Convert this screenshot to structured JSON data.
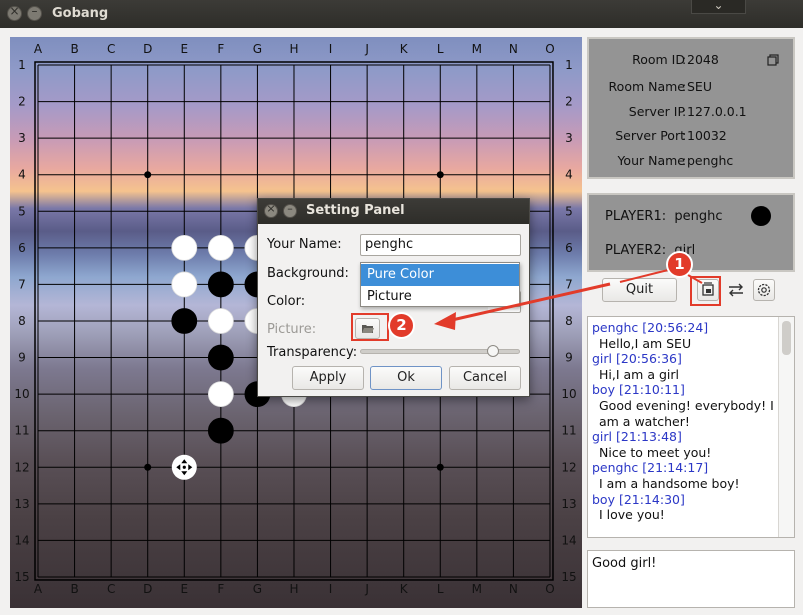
{
  "window": {
    "title": "Gobang",
    "menu_glyph": "⌄"
  },
  "board": {
    "column_labels": [
      "A",
      "B",
      "C",
      "D",
      "E",
      "F",
      "G",
      "H",
      "I",
      "J",
      "K",
      "L",
      "M",
      "N",
      "O"
    ],
    "row_labels": [
      "1",
      "2",
      "3",
      "4",
      "5",
      "6",
      "7",
      "8",
      "9",
      "10",
      "11",
      "12",
      "13",
      "14",
      "15"
    ],
    "star_points": [
      [
        "D",
        4
      ],
      [
        "L",
        4
      ],
      [
        "D",
        12
      ],
      [
        "L",
        12
      ]
    ],
    "stones": [
      {
        "col": "E",
        "row": 6,
        "color": "white"
      },
      {
        "col": "F",
        "row": 6,
        "color": "white"
      },
      {
        "col": "G",
        "row": 6,
        "color": "white"
      },
      {
        "col": "E",
        "row": 7,
        "color": "white"
      },
      {
        "col": "F",
        "row": 7,
        "color": "black"
      },
      {
        "col": "G",
        "row": 7,
        "color": "black"
      },
      {
        "col": "E",
        "row": 8,
        "color": "black"
      },
      {
        "col": "F",
        "row": 8,
        "color": "white"
      },
      {
        "col": "G",
        "row": 8,
        "color": "white"
      },
      {
        "col": "F",
        "row": 9,
        "color": "black"
      },
      {
        "col": "F",
        "row": 10,
        "color": "white"
      },
      {
        "col": "G",
        "row": 10,
        "color": "black"
      },
      {
        "col": "H",
        "row": 10,
        "color": "white"
      },
      {
        "col": "F",
        "row": 11,
        "color": "black"
      }
    ],
    "cursor": {
      "col": "E",
      "row": 12
    }
  },
  "room": {
    "rows": [
      {
        "label": "Room  ID",
        "value": "2048"
      },
      {
        "label": "Room Name",
        "value": "SEU"
      },
      {
        "label": "Server IP",
        "value": "127.0.0.1"
      },
      {
        "label": "Server Port",
        "value": "10032"
      },
      {
        "label": "Your Name",
        "value": "penghc"
      }
    ],
    "copy_icon": "copy-icon"
  },
  "players": {
    "p1_label": "PLAYER1:",
    "p1_name": "penghc",
    "p2_label": "PLAYER2:",
    "p2_name": "girl"
  },
  "controls": {
    "quit_label": "Quit",
    "icons": [
      "screenshot-icon",
      "swap-icon",
      "settings-gear-icon"
    ]
  },
  "chat": {
    "messages": [
      {
        "head": "penghc [20:56:24]",
        "body": "Hello,I am SEU"
      },
      {
        "head": "girl [20:56:36]",
        "body": "Hi,I am a girl"
      },
      {
        "head": "boy [21:10:11]",
        "body": "Good evening! everybody! I am a watcher!"
      },
      {
        "head": "girl [21:13:48]",
        "body": "Nice to meet you!"
      },
      {
        "head": "penghc [21:14:17]",
        "body": "I am a handsome boy!"
      },
      {
        "head": "boy [21:14:30]",
        "body": "I love you!"
      }
    ],
    "input_value": "Good girl!"
  },
  "dialog": {
    "title": "Setting Panel",
    "name_label": "Your Name:",
    "name_value": "penghc",
    "background_label": "Background:",
    "background_options": [
      "Pure Color",
      "Picture"
    ],
    "background_selected": "Pure Color",
    "color_label": "Color:",
    "picture_label": "Picture:",
    "transparency_label": "Transparency:",
    "transparency_value": 0.84,
    "apply_label": "Apply",
    "ok_label": "Ok",
    "cancel_label": "Cancel"
  },
  "annotations": {
    "callout1": "1",
    "callout2": "2",
    "color": "#e23b2a"
  }
}
